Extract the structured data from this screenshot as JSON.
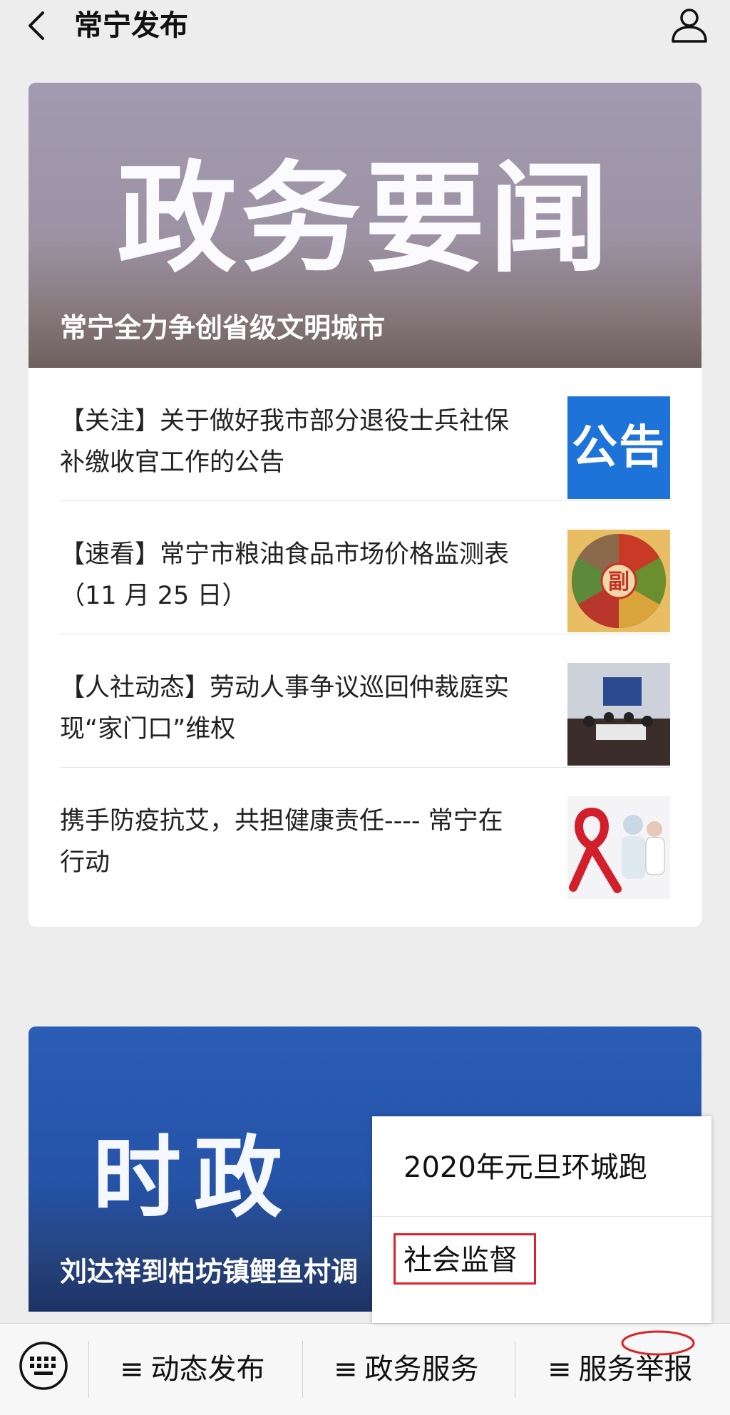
{
  "header": {
    "title": "常宁发布",
    "back_icon": "chevron-left-icon",
    "profile_icon": "person-icon"
  },
  "card1": {
    "hero_text": "政务要闻",
    "hero_caption": "常宁全力争创省级文明城市",
    "news": [
      {
        "title_line1": "【关注】关于做好我市部分退役士兵社保",
        "title_line2": "补缴收官工作的公告",
        "thumb_text": "公告"
      },
      {
        "title_line1": "【速看】常宁市粮油食品市场价格监测表",
        "title_line2": "（11 月 25 日）",
        "thumb_text": "副"
      },
      {
        "title_line1": "【人社动态】劳动人事争议巡回仲裁庭实",
        "title_line2": "现“家门口”维权"
      },
      {
        "title_line1": "携手防疫抗艾，共担健康责任---- 常宁在",
        "title_line2": "行动"
      }
    ]
  },
  "card2": {
    "hero_text": "时政",
    "hero_caption": "刘达祥到柏坊镇鲤鱼村调"
  },
  "popup": {
    "item1": "2020年元旦环城跑",
    "item2": "社会监督"
  },
  "bottom_menu": {
    "keyboard_icon": "keyboard-icon",
    "ham_glyph": "≡",
    "btn1": "动态发布",
    "btn2": "政务服务",
    "btn3": "服务举报"
  },
  "colors": {
    "highlight": "#d8232a",
    "notice_blue": "#1e73d8"
  }
}
